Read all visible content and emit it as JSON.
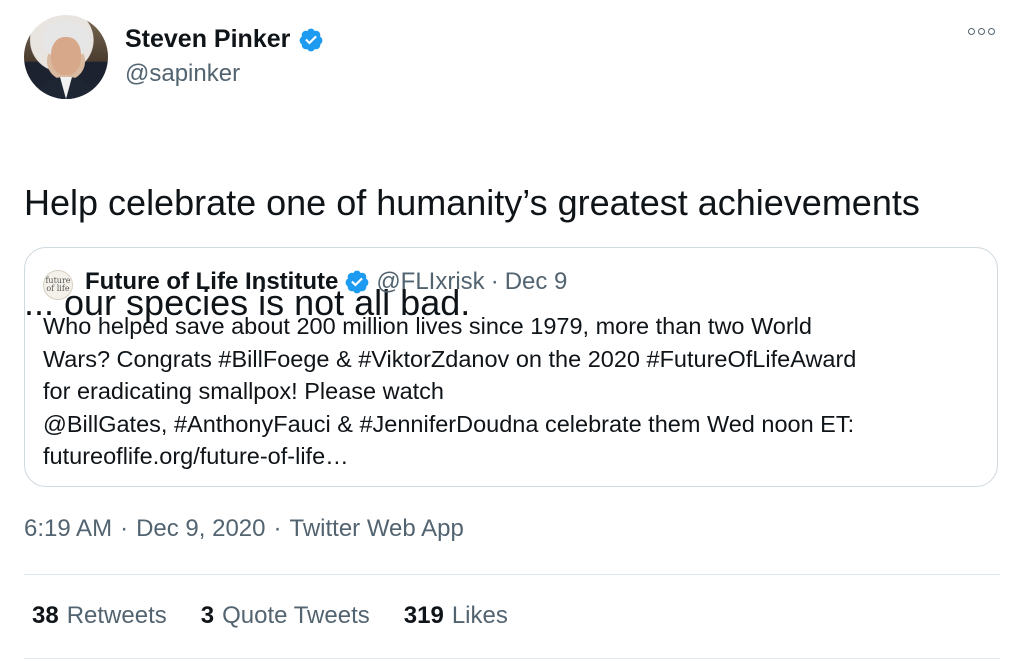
{
  "author": {
    "display_name": "Steven Pinker",
    "handle": "@sapinker",
    "verified": true
  },
  "icons": {
    "verified": "verified-badge-icon",
    "more": "more-options-icon"
  },
  "tweet": {
    "text_lines": [
      "Help celebrate one of humanity’s greatest achievements",
      "... our species is not all bad."
    ]
  },
  "quoted_tweet": {
    "avatar_text": "future of life",
    "display_name": "Future of Life Institute",
    "handle": "@FLIxrisk",
    "separator": "·",
    "date": "Dec 9",
    "body_lines": [
      "Who helped save about 200 million lives since 1979, more than two World",
      "Wars? Congrats #BillFoege & #ViktorZdanov on the 2020 #FutureOfLifeAward",
      "for eradicating smallpox! Please watch",
      "@BillGates, #AnthonyFauci & #JenniferDoudna celebrate them Wed noon ET:",
      "futureoflife.org/future-of-life…"
    ]
  },
  "meta": {
    "time": "6:19 AM",
    "sep1": "·",
    "date": "Dec 9, 2020",
    "sep2": "·",
    "source": "Twitter Web App"
  },
  "stats": {
    "retweets_count": "38",
    "retweets_label": "Retweets",
    "quotes_count": "3",
    "quotes_label": "Quote Tweets",
    "likes_count": "319",
    "likes_label": "Likes"
  },
  "colors": {
    "verified_blue": "#1d9bf0",
    "secondary_text": "#536471",
    "primary_text": "#0f1419",
    "border": "#cfd9de"
  }
}
